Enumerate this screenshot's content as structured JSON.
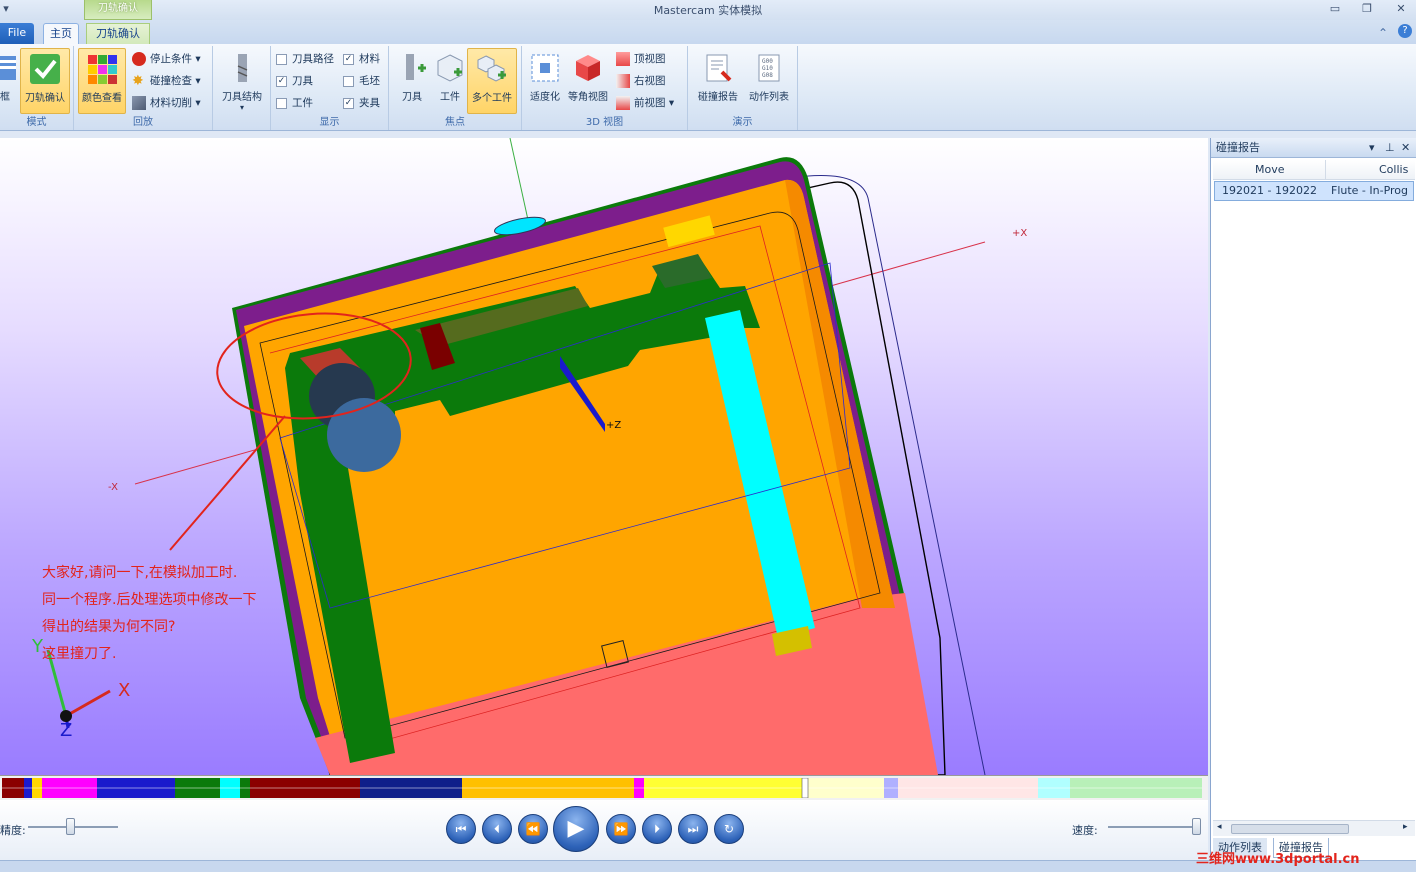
{
  "window": {
    "title": "Mastercam 实体模拟",
    "context_group": "刀轨确认"
  },
  "tabs": {
    "file": "File",
    "home": "主页",
    "context": "刀轨确认"
  },
  "ribbon": {
    "mode": {
      "label": "模式",
      "frame": "框",
      "verify": "刀轨确认"
    },
    "playback": {
      "label": "回放",
      "color_view": "颜色查看",
      "stop_cond": "停止条件",
      "collision_check": "碰撞检查",
      "material_cut": "材料切削"
    },
    "tool_struct": {
      "label": "刀具结构"
    },
    "display": {
      "label": "显示",
      "toolpath": "刀具路径",
      "tool": "刀具",
      "workpiece": "工件",
      "material": "材料",
      "stock": "毛坯",
      "fixture": "夹具"
    },
    "focus": {
      "label": "焦点",
      "tool": "刀具",
      "workpiece": "工件",
      "multi": "多个工件"
    },
    "view3d": {
      "label": "3D 视图",
      "fit": "适度化",
      "iso": "等角视图",
      "top": "顶视图",
      "right": "右视图",
      "front": "前视图"
    },
    "demo": {
      "label": "演示",
      "collision_report": "碰撞报告",
      "action_list": "动作列表"
    }
  },
  "annotation": {
    "line1": "大家好,请问一下,在模拟加工时.",
    "line2": "同一个程序.后处理选项中修改一下",
    "line3": "得出的结果为何不同?",
    "line4": "这里撞刀了."
  },
  "axes": {
    "plus_x": "+X",
    "minus_x": "-X",
    "plus_z": "+Z",
    "x": "X",
    "y": "Y",
    "z": "Z"
  },
  "playback": {
    "speed_left": "精度:",
    "speed_right": "速度:"
  },
  "panel": {
    "title": "碰撞报告",
    "col_move": "Move",
    "col_collision": "Collis",
    "row_move": "192021 - 192022",
    "row_collision": "Flute - In-Prog",
    "tab_actions": "动作列表",
    "tab_collision": "碰撞报告"
  },
  "watermark": "三维网www.3dportal.cn",
  "colors": {
    "accent": "#ffd467",
    "annotation": "#e2241c",
    "orange": "#ffa500",
    "green": "#0b7a0b",
    "cyan": "#00ffff",
    "salmon": "#ff6b6b"
  }
}
